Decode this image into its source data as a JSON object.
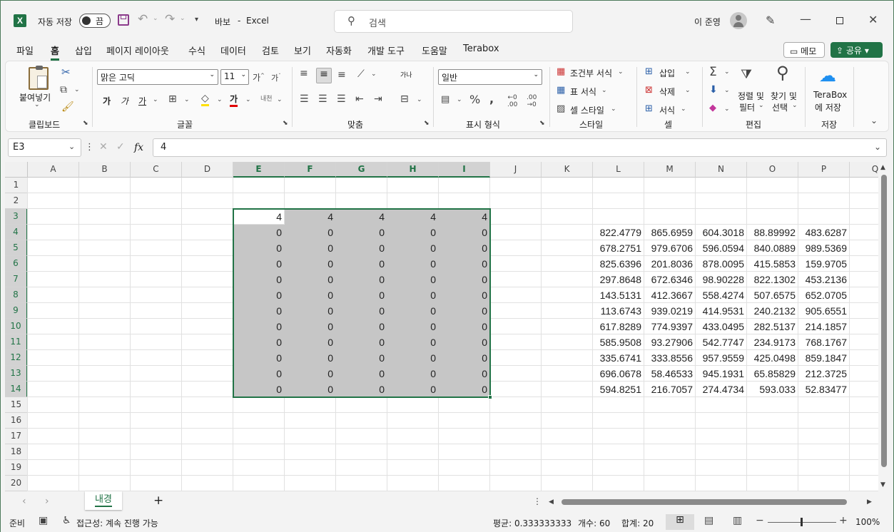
{
  "titlebar": {
    "autosave_label": "자동 저장",
    "autosave_state": "끔",
    "filename": "바보",
    "separator": "-",
    "app_name": "Excel",
    "search_placeholder": "검색",
    "user_name": "이 준영",
    "brand_color": "#217346"
  },
  "menu": {
    "items": [
      "파일",
      "홈",
      "삽입",
      "페이지 레이아웃",
      "수식",
      "데이터",
      "검토",
      "보기",
      "자동화",
      "개발 도구",
      "도움말",
      "Terabox"
    ],
    "active": "홈",
    "memo_label": "메모",
    "share_label": "공유"
  },
  "ribbon": {
    "clipboard": {
      "paste_label": "붙여넣기",
      "group_label": "클립보드"
    },
    "font": {
      "font_name": "맑은 고딕",
      "font_size": "11",
      "bold": "가",
      "italic": "가",
      "underline": "가",
      "font_color_glyph": "가",
      "phonetic": "내천",
      "group_label": "글꼴"
    },
    "alignment": {
      "group_label": "맞춤",
      "wrap_glyph": "가나"
    },
    "number": {
      "format": "일반",
      "group_label": "표시 형식"
    },
    "styles": {
      "conditional": "조건부 서식",
      "table": "표 서식",
      "cell": "셀 스타일",
      "group_label": "스타일"
    },
    "cells": {
      "insert": "삽입",
      "delete": "삭제",
      "format": "서식",
      "group_label": "셀"
    },
    "editing": {
      "sort1": "정렬 및",
      "sort2": "필터",
      "find1": "찾기 및",
      "find2": "선택",
      "group_label": "편집"
    },
    "save": {
      "terabox1": "TeraBox",
      "terabox2": "에 저장",
      "group_label": "저장"
    }
  },
  "formula_bar": {
    "name_box": "E3",
    "fx": "fx",
    "formula": "4"
  },
  "sheet": {
    "columns": [
      "A",
      "B",
      "C",
      "D",
      "E",
      "F",
      "G",
      "H",
      "I",
      "J",
      "K",
      "L",
      "M",
      "N",
      "O",
      "P",
      "Q"
    ],
    "rows": [
      "1",
      "2",
      "3",
      "4",
      "5",
      "6",
      "7",
      "8",
      "9",
      "10",
      "11",
      "12",
      "13",
      "14",
      "15",
      "16",
      "17",
      "18",
      "19",
      "20"
    ],
    "selection_range": "E3:I14",
    "ei_row3": [
      "4",
      "4",
      "4",
      "4",
      "4"
    ],
    "ei_zero_rows": [
      [
        "0",
        "0",
        "0",
        "0",
        "0"
      ],
      [
        "0",
        "0",
        "0",
        "0",
        "0"
      ],
      [
        "0",
        "0",
        "0",
        "0",
        "0"
      ],
      [
        "0",
        "0",
        "0",
        "0",
        "0"
      ],
      [
        "0",
        "0",
        "0",
        "0",
        "0"
      ],
      [
        "0",
        "0",
        "0",
        "0",
        "0"
      ],
      [
        "0",
        "0",
        "0",
        "0",
        "0"
      ],
      [
        "0",
        "0",
        "0",
        "0",
        "0"
      ],
      [
        "0",
        "0",
        "0",
        "0",
        "0"
      ],
      [
        "0",
        "0",
        "0",
        "0",
        "0"
      ],
      [
        "0",
        "0",
        "0",
        "0",
        "0"
      ]
    ],
    "lp_rows": [
      [
        "822.4779",
        "865.6959",
        "604.3018",
        "88.89992",
        "483.6287"
      ],
      [
        "678.2751",
        "979.6706",
        "596.0594",
        "840.0889",
        "989.5369"
      ],
      [
        "825.6396",
        "201.8036",
        "878.0095",
        "415.5853",
        "159.9705"
      ],
      [
        "297.8648",
        "672.6346",
        "98.90228",
        "822.1302",
        "453.2136"
      ],
      [
        "143.5131",
        "412.3667",
        "558.4274",
        "507.6575",
        "652.0705"
      ],
      [
        "113.6743",
        "939.0219",
        "414.9531",
        "240.2132",
        "905.6551"
      ],
      [
        "617.8289",
        "774.9397",
        "433.0495",
        "282.5137",
        "214.1857"
      ],
      [
        "585.9508",
        "93.27906",
        "542.7747",
        "234.9173",
        "768.1767"
      ],
      [
        "335.6741",
        "333.8556",
        "957.9559",
        "425.0498",
        "859.1847"
      ],
      [
        "696.0678",
        "58.46533",
        "945.1931",
        "65.85829",
        "212.3725"
      ],
      [
        "594.8251",
        "216.7057",
        "274.4734",
        "593.033",
        "52.83477"
      ]
    ]
  },
  "tabs": {
    "sheet_name": "내경",
    "add": "+"
  },
  "status": {
    "ready": "준비",
    "accessibility": "접근성: 계속 진행 가능",
    "average": "평균: 0.333333333",
    "count": "개수: 60",
    "sum": "합계: 20",
    "zoom": "100%"
  }
}
